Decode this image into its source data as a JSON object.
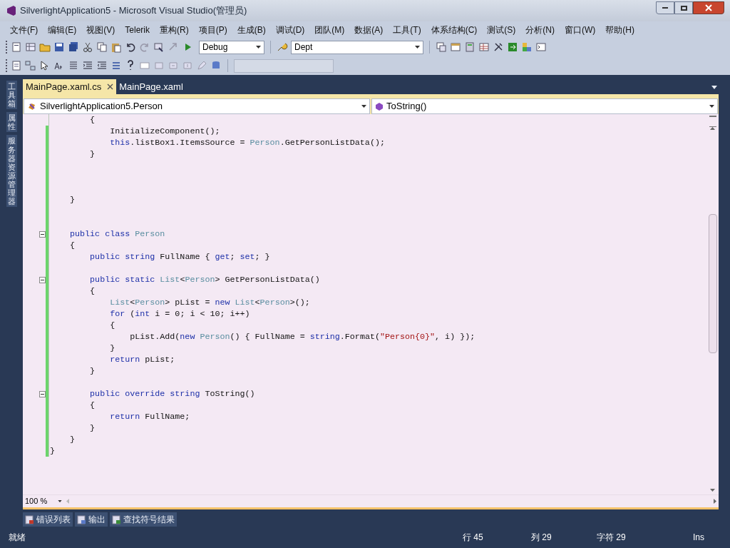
{
  "window": {
    "title": "SilverlightApplication5 - Microsoft Visual Studio(管理员)"
  },
  "menu": [
    "文件(F)",
    "编辑(E)",
    "视图(V)",
    "Telerik",
    "重构(R)",
    "项目(P)",
    "生成(B)",
    "调试(D)",
    "团队(M)",
    "数据(A)",
    "工具(T)",
    "体系结构(C)",
    "测试(S)",
    "分析(N)",
    "窗口(W)",
    "帮助(H)"
  ],
  "toolbar": {
    "configuration": "Debug",
    "find": "Dept"
  },
  "side_tabs": [
    "工具箱",
    "属性",
    "服务器资源管理器"
  ],
  "doc_tabs": [
    {
      "label": "MainPage.xaml.cs",
      "selected": true
    },
    {
      "label": "MainPage.xaml",
      "selected": false
    }
  ],
  "nav": {
    "type": "SilverlightApplication5.Person",
    "member": "ToString()"
  },
  "code": [
    {
      "changed": false,
      "fold_marker": false,
      "tokens": [
        {
          "kind": "plain",
          "text": "        {"
        }
      ]
    },
    {
      "changed": true,
      "fold_marker": false,
      "tokens": [
        {
          "kind": "plain",
          "text": "            InitializeComponent();"
        }
      ]
    },
    {
      "changed": true,
      "fold_marker": false,
      "tokens": [
        {
          "kind": "keyword",
          "text": "            this"
        },
        {
          "kind": "plain",
          "text": ".listBox1.ItemsSource = "
        },
        {
          "kind": "type",
          "text": "Person"
        },
        {
          "kind": "plain",
          "text": ".GetPersonListData();"
        }
      ]
    },
    {
      "changed": true,
      "fold_marker": false,
      "tokens": [
        {
          "kind": "plain",
          "text": "        }"
        }
      ]
    },
    {
      "changed": true,
      "fold_marker": false
    },
    {
      "changed": true,
      "fold_marker": false
    },
    {
      "changed": true,
      "fold_marker": false
    },
    {
      "changed": true,
      "fold_marker": false,
      "tokens": [
        {
          "kind": "plain",
          "text": "    }"
        }
      ]
    },
    {
      "changed": true,
      "fold_marker": false
    },
    {
      "changed": true,
      "fold_marker": false
    },
    {
      "changed": true,
      "fold_marker": true,
      "tokens": [
        {
          "kind": "keyword",
          "text": "    public class "
        },
        {
          "kind": "type",
          "text": "Person"
        }
      ]
    },
    {
      "changed": true,
      "fold_marker": false,
      "tokens": [
        {
          "kind": "plain",
          "text": "    {"
        }
      ]
    },
    {
      "changed": true,
      "fold_marker": false,
      "tokens": [
        {
          "kind": "keyword",
          "text": "        public string "
        },
        {
          "kind": "plain",
          "text": "FullName { "
        },
        {
          "kind": "keyword",
          "text": "get"
        },
        {
          "kind": "plain",
          "text": "; "
        },
        {
          "kind": "keyword",
          "text": "set"
        },
        {
          "kind": "plain",
          "text": "; }"
        }
      ]
    },
    {
      "changed": true,
      "fold_marker": false
    },
    {
      "changed": true,
      "fold_marker": true,
      "tokens": [
        {
          "kind": "keyword",
          "text": "        public static "
        },
        {
          "kind": "type",
          "text": "List"
        },
        {
          "kind": "plain",
          "text": "<"
        },
        {
          "kind": "type",
          "text": "Person"
        },
        {
          "kind": "plain",
          "text": "> GetPersonListData()"
        }
      ]
    },
    {
      "changed": true,
      "fold_marker": false,
      "tokens": [
        {
          "kind": "plain",
          "text": "        {"
        }
      ]
    },
    {
      "changed": true,
      "fold_marker": false,
      "tokens": [
        {
          "kind": "type",
          "text": "            List"
        },
        {
          "kind": "plain",
          "text": "<"
        },
        {
          "kind": "type",
          "text": "Person"
        },
        {
          "kind": "plain",
          "text": "> pList = "
        },
        {
          "kind": "keyword",
          "text": "new "
        },
        {
          "kind": "type",
          "text": "List"
        },
        {
          "kind": "plain",
          "text": "<"
        },
        {
          "kind": "type",
          "text": "Person"
        },
        {
          "kind": "plain",
          "text": ">();"
        }
      ]
    },
    {
      "changed": true,
      "fold_marker": false,
      "tokens": [
        {
          "kind": "keyword",
          "text": "            for"
        },
        {
          "kind": "plain",
          "text": " ("
        },
        {
          "kind": "keyword",
          "text": "int"
        },
        {
          "kind": "plain",
          "text": " i = 0; i < 10; i++)"
        }
      ]
    },
    {
      "changed": true,
      "fold_marker": false,
      "tokens": [
        {
          "kind": "plain",
          "text": "            {"
        }
      ]
    },
    {
      "changed": true,
      "fold_marker": false,
      "tokens": [
        {
          "kind": "plain",
          "text": "                pList.Add("
        },
        {
          "kind": "keyword",
          "text": "new "
        },
        {
          "kind": "type",
          "text": "Person"
        },
        {
          "kind": "plain",
          "text": "() { FullName = "
        },
        {
          "kind": "keyword",
          "text": "string"
        },
        {
          "kind": "plain",
          "text": ".Format("
        },
        {
          "kind": "string",
          "text": "\"Person{0}\""
        },
        {
          "kind": "plain",
          "text": ", i) });"
        }
      ]
    },
    {
      "changed": true,
      "fold_marker": false,
      "tokens": [
        {
          "kind": "plain",
          "text": "            }"
        }
      ]
    },
    {
      "changed": true,
      "fold_marker": false,
      "tokens": [
        {
          "kind": "keyword",
          "text": "            return"
        },
        {
          "kind": "plain",
          "text": " pList;"
        }
      ]
    },
    {
      "changed": true,
      "fold_marker": false,
      "tokens": [
        {
          "kind": "plain",
          "text": "        }"
        }
      ]
    },
    {
      "changed": true,
      "fold_marker": false
    },
    {
      "changed": true,
      "fold_marker": true,
      "tokens": [
        {
          "kind": "keyword",
          "text": "        public override string "
        },
        {
          "kind": "plain",
          "text": "ToString()"
        }
      ]
    },
    {
      "changed": true,
      "fold_marker": false,
      "tokens": [
        {
          "kind": "plain",
          "text": "        {"
        }
      ]
    },
    {
      "changed": true,
      "fold_marker": false,
      "tokens": [
        {
          "kind": "keyword",
          "text": "            return"
        },
        {
          "kind": "plain",
          "text": " FullName;"
        }
      ]
    },
    {
      "changed": true,
      "fold_marker": false,
      "tokens": [
        {
          "kind": "plain",
          "text": "        }"
        }
      ]
    },
    {
      "changed": true,
      "fold_marker": false,
      "tokens": [
        {
          "kind": "plain",
          "text": "    }"
        }
      ]
    },
    {
      "changed": true,
      "fold_marker": false,
      "tokens": [
        {
          "kind": "plain",
          "text": "}"
        }
      ]
    }
  ],
  "zoom": "100 %",
  "tool_windows": [
    "错误列表",
    "输出",
    "查找符号结果"
  ],
  "status": {
    "message": "就绪",
    "line": "行 45",
    "column": "列 29",
    "char": "字符 29",
    "mode": "Ins"
  }
}
